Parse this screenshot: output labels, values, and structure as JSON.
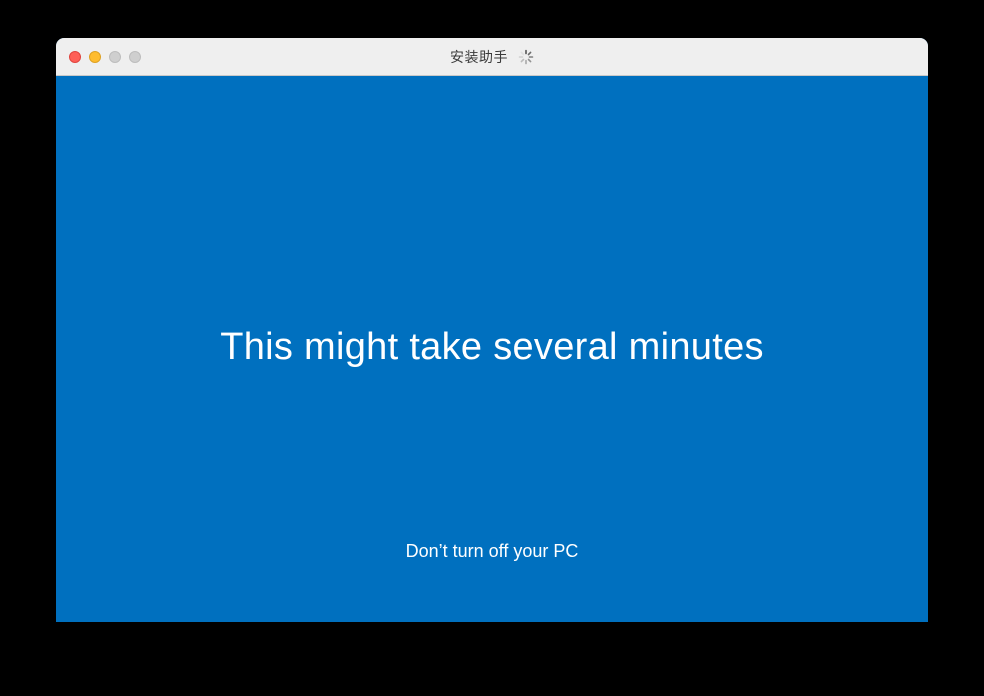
{
  "window": {
    "title": "安装助手",
    "status_icon": "loading-spinner-icon"
  },
  "controls": {
    "close": "close-icon",
    "minimize": "minimize-icon",
    "zoom": "zoom-icon"
  },
  "content": {
    "headline": "This might take several minutes",
    "subline": "Don’t turn off your PC",
    "background_color": "#0070bf",
    "text_color": "#ffffff"
  }
}
